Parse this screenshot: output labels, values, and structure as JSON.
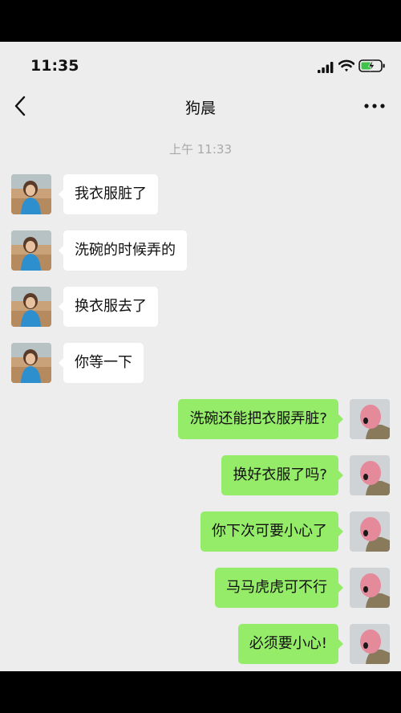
{
  "status_bar": {
    "time": "11:35"
  },
  "header": {
    "title": "狗晨"
  },
  "timestamp": "上午 11:33",
  "messages_in": [
    {
      "text": "我衣服脏了"
    },
    {
      "text": "洗碗的时候弄的"
    },
    {
      "text": "换衣服去了"
    },
    {
      "text": "你等一下"
    }
  ],
  "messages_out": [
    {
      "text": "洗碗还能把衣服弄脏?"
    },
    {
      "text": "换好衣服了吗?"
    },
    {
      "text": "你下次可要小心了"
    },
    {
      "text": "马马虎虎可不行"
    },
    {
      "text": "必须要小心!"
    }
  ],
  "colors": {
    "background": "#ededed",
    "incoming_bubble": "#ffffff",
    "outgoing_bubble": "#95ec69",
    "timestamp": "#a8a8a8",
    "battery_charging": "#3ec34a"
  },
  "icons": {
    "back": "chevron-left-icon",
    "more": "more-icon",
    "signal": "cellular-signal-icon",
    "wifi": "wifi-icon",
    "battery": "battery-charging-icon"
  }
}
